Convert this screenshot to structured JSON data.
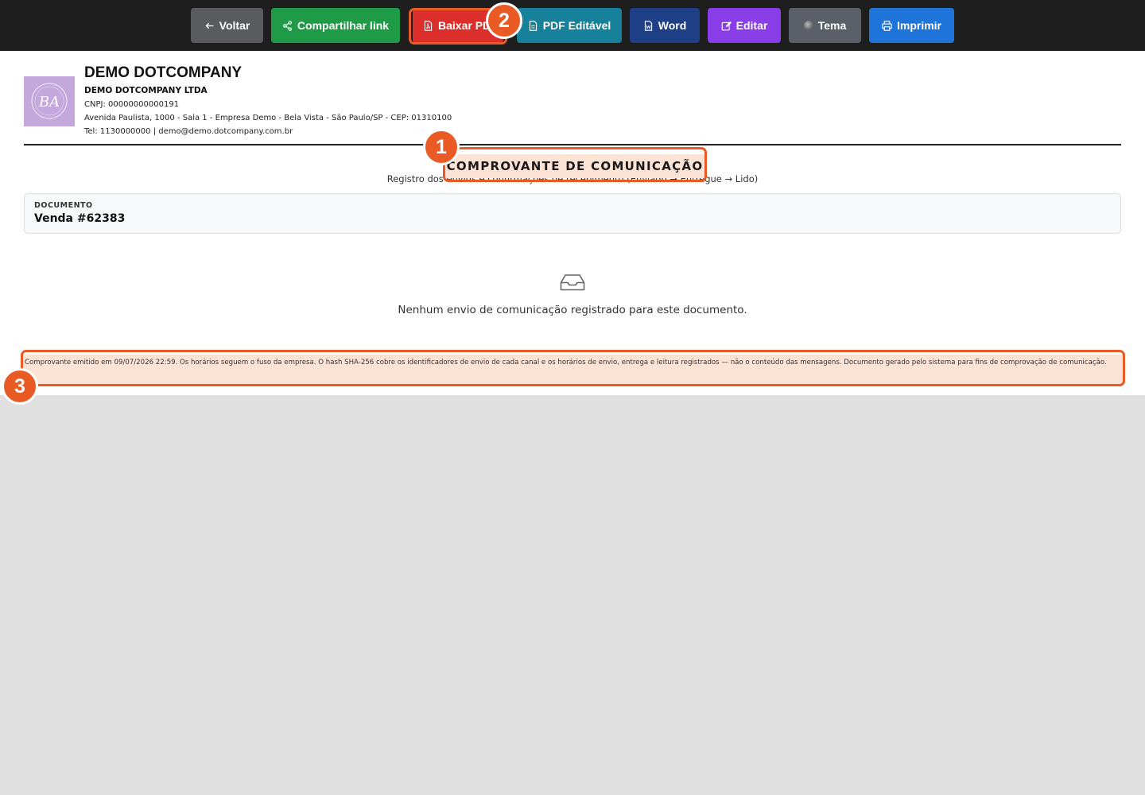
{
  "toolbar": {
    "buttons": [
      {
        "label": "Voltar",
        "icon": "arrow-left-icon"
      },
      {
        "label": "Compartilhar link",
        "icon": "share-icon"
      },
      {
        "label": "Baixar PDF",
        "icon": "pdf-file-icon"
      },
      {
        "label": "PDF Editável",
        "icon": "file-icon"
      },
      {
        "label": "Word",
        "icon": "word-file-icon"
      },
      {
        "label": "Editar",
        "icon": "edit-icon"
      },
      {
        "label": "Tema",
        "icon": "theme-icon"
      },
      {
        "label": "Imprimir",
        "icon": "printer-icon"
      }
    ],
    "colors": {
      "voltar": "#5a5b5f",
      "share": "#1f9a46",
      "pdf": "#dc2f2b",
      "pdf_editavel": "#17809a",
      "word": "#1f3f86",
      "editar": "#8a3ee8",
      "tema": "#5a5f68",
      "imprimir": "#1e74d8"
    }
  },
  "company": {
    "name": "DEMO DOTCOMPANY",
    "legal_name": "DEMO DOTCOMPANY LTDA",
    "cnpj": "CNPJ: 00000000000191",
    "address": "Avenida Paulista, 1000 - Sala 1 - Empresa Demo - Bela Vista - São Paulo/SP - CEP: 01310100",
    "contact": "Tel: 1130000000  |  demo@demo.dotcompany.com.br",
    "logo_text": "BA"
  },
  "document": {
    "title": "COMPROVANTE DE COMUNICAÇÃO",
    "subtitle": "Registro dos envios e confirmações de recebimento (Enviado → Entregue → Lido)",
    "ref_label": "DOCUMENTO",
    "ref_value": "Venda #62383",
    "empty_icon": "inbox-icon",
    "empty_message": "Nenhum envio de comunicação registrado para este documento.",
    "footer_note": "Comprovante emitido em 09/07/2026 22:59. Os horários seguem o fuso da empresa. O hash SHA-256 cobre os identificadores de envio de cada canal e os horários de envio, entrega e leitura registrados — não o conteúdo das mensagens. Documento gerado pelo sistema para fins de comprovação de comunicação."
  },
  "annotations": [
    {
      "number": "1",
      "target": "document-title"
    },
    {
      "number": "2",
      "target": "download-pdf-button"
    },
    {
      "number": "3",
      "target": "footer-note"
    }
  ],
  "accent_color": "#ea5a25"
}
